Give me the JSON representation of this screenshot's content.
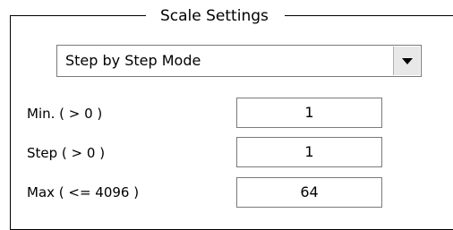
{
  "group": {
    "title": "Scale Settings"
  },
  "mode_select": {
    "value": "Step by Step Mode",
    "icon": "chevron-down-icon"
  },
  "fields": [
    {
      "label": "Min. ( > 0 )",
      "value": "1"
    },
    {
      "label": "Step ( > 0 )",
      "value": "1"
    },
    {
      "label": "Max  ( <= 4096 )",
      "value": "64"
    }
  ]
}
